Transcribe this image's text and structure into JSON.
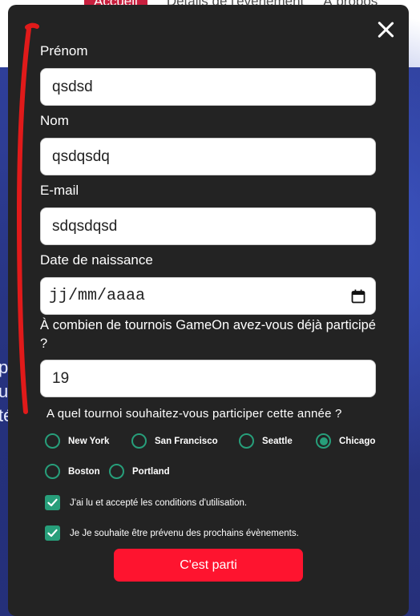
{
  "background_page": {
    "nav": [
      "Accueil",
      "Détails de l'évènement",
      "À propos"
    ],
    "hero_fragments": [
      "p",
      "uv",
      "té"
    ]
  },
  "form": {
    "close_icon": "close-icon",
    "first_name": {
      "label": "Prénom",
      "value": "qsdsd"
    },
    "last_name": {
      "label": "Nom",
      "value": "qsdqsdq"
    },
    "email": {
      "label": "E-mail",
      "value": "sdqsdqsd"
    },
    "birthdate": {
      "label": "Date de naissance",
      "placeholder": "jj/mm/aaaa",
      "icon": "calendar-icon"
    },
    "tournaments_count": {
      "label": "À combien de tournois GameOn avez-vous déjà participé ?",
      "value": "19"
    },
    "location_question": "A quel tournoi souhaitez-vous participer cette année ?",
    "locations": [
      {
        "label": "New York",
        "checked": false
      },
      {
        "label": "San Francisco",
        "checked": false
      },
      {
        "label": "Seattle",
        "checked": false
      },
      {
        "label": "Chicago",
        "checked": true
      },
      {
        "label": "Boston",
        "checked": false
      },
      {
        "label": "Portland",
        "checked": false
      }
    ],
    "checkbox_terms": {
      "label": "J'ai lu et accepté les conditions d'utilisation.",
      "checked": true
    },
    "checkbox_newsletter": {
      "label": "Je Je souhaite être prévenu des prochains évènements.",
      "checked": true
    },
    "submit_label": "C'est parti"
  },
  "colors": {
    "modal_bg": "#232323",
    "accent_green": "#279e7a",
    "submit_red": "#fe142f",
    "annotation_red": "#e01a1a"
  }
}
